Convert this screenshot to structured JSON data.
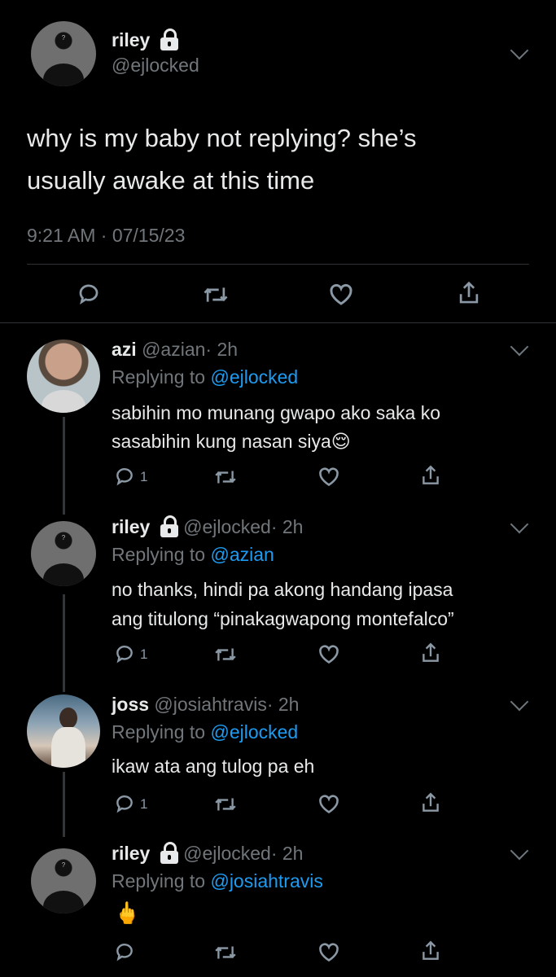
{
  "main_tweet": {
    "name": "riley",
    "handle": "@ejlocked",
    "text_line1": "why is my baby not replying? she’s",
    "text_line2": "usually awake at  this time",
    "timestamp": "9:21 AM · 07/15/23",
    "avatar_mark": "?"
  },
  "replies": [
    {
      "name": "azi",
      "handle": "@azian",
      "time": "· 2h",
      "replying_prefix": "Replying to",
      "replying_to": "@ejlocked",
      "line1": "sabihin mo munang gwapo ako saka ko",
      "line2": "sasabihin kung nasan siya",
      "emoji": "😌",
      "reply_count": "1"
    },
    {
      "name": "riley",
      "handle": "@ejlocked",
      "time": "· 2h",
      "replying_prefix": "Replying to",
      "replying_to": "@azian",
      "line1": "no thanks, hindi pa akong handang ipasa",
      "line2": "ang titulong “pinakagwapong montefalco”",
      "reply_count": "1",
      "avatar_mark": "?"
    },
    {
      "name": "joss",
      "handle": "@josiahtravis",
      "time": "· 2h",
      "replying_prefix": "Replying to",
      "replying_to": "@ejlocked",
      "line1": "ikaw ata ang tulog pa eh",
      "reply_count": "1"
    },
    {
      "name": "riley",
      "handle": "@ejlocked",
      "time": "· 2h",
      "replying_prefix": "Replying to",
      "replying_to": "@josiahtravis",
      "emoji": "🖕",
      "avatar_mark": "?"
    }
  ],
  "icons": [
    "reply-icon",
    "retweet-icon",
    "like-icon",
    "share-icon",
    "lock-icon",
    "chevron-down-icon"
  ],
  "colors": {
    "background": "#000000",
    "link": "#1d9bf0",
    "muted": "#71767b",
    "text": "#e7e9ea"
  }
}
